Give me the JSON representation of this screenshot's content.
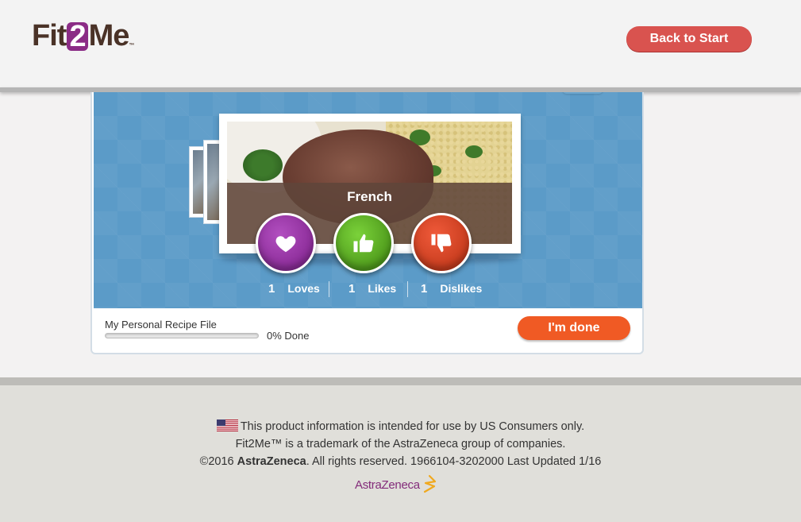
{
  "header": {
    "logo": {
      "part1": "Fit",
      "part2": "2",
      "part3": "Me",
      "tm": "™"
    },
    "back_button": "Back to Start"
  },
  "recipe": {
    "caption": "French",
    "buttons": {
      "love_icon": "heart-icon",
      "like_icon": "thumbs-up-icon",
      "dislike_icon": "thumbs-down-icon"
    },
    "counts": [
      {
        "num": "1",
        "label": "Loves"
      },
      {
        "num": "1",
        "label": "Likes"
      },
      {
        "num": "1",
        "label": "Dislikes"
      }
    ]
  },
  "progress": {
    "label": "My Personal Recipe File",
    "percent": 0,
    "text": "0% Done",
    "done_button": "I'm done"
  },
  "footer": {
    "line1": "This product information is intended for use by US Consumers only.",
    "line2": "Fit2Me™ is a trademark of the AstraZeneca group of companies.",
    "line3_prefix": "©2016 ",
    "line3_brand": "AstraZeneca",
    "line3_suffix": ". All rights reserved. 1966104-3202000 Last Updated 1/16",
    "brand_logo": "AstraZeneca"
  },
  "colors": {
    "brand_purple": "#8b2c86",
    "back_button": "#d9534f",
    "done_button": "#f05a24",
    "stage_blue": "#5b9bc8",
    "love": "#8b2c98",
    "like": "#4f9b1c",
    "dislike": "#c73c1e"
  }
}
